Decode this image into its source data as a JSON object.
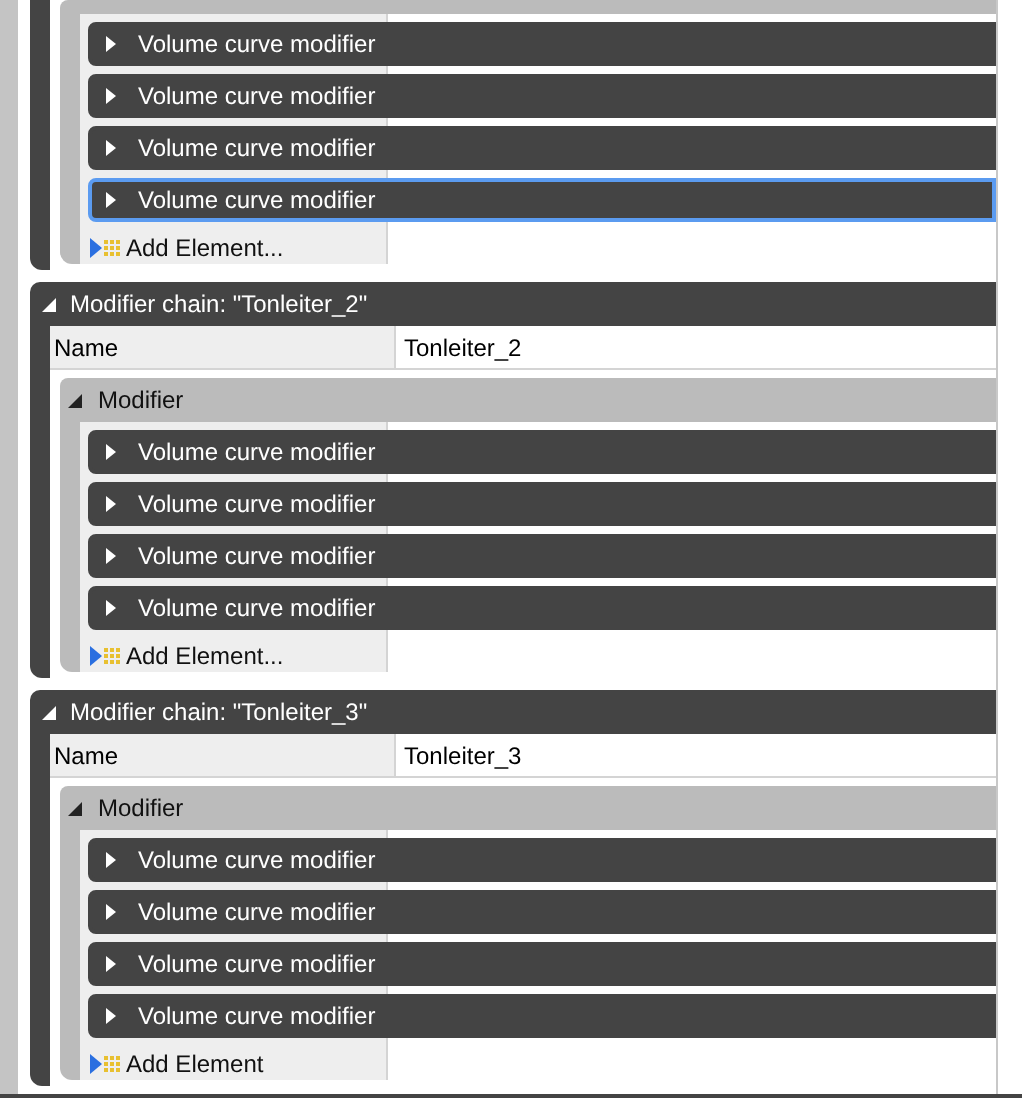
{
  "chains": [
    {
      "group": {
        "rows": [
          {
            "label": "Volume curve modifier",
            "selected": false
          },
          {
            "label": "Volume curve modifier",
            "selected": false
          },
          {
            "label": "Volume curve modifier",
            "selected": false
          },
          {
            "label": "Volume curve modifier",
            "selected": true
          }
        ],
        "add_label": "Add Element..."
      }
    },
    {
      "title": "Modifier chain: \"Tonleiter_2\"",
      "name_label": "Name",
      "name_value": "Tonleiter_2",
      "group": {
        "title": "Modifier",
        "rows": [
          {
            "label": "Volume curve modifier",
            "selected": false
          },
          {
            "label": "Volume curve modifier",
            "selected": false
          },
          {
            "label": "Volume curve modifier",
            "selected": false
          },
          {
            "label": "Volume curve modifier",
            "selected": false
          }
        ],
        "add_label": "Add Element..."
      }
    },
    {
      "title": "Modifier chain: \"Tonleiter_3\"",
      "name_label": "Name",
      "name_value": "Tonleiter_3",
      "group": {
        "title": "Modifier",
        "rows": [
          {
            "label": "Volume curve modifier",
            "selected": false
          },
          {
            "label": "Volume curve modifier",
            "selected": false
          },
          {
            "label": "Volume curve modifier",
            "selected": false
          },
          {
            "label": "Volume curve modifier",
            "selected": false
          }
        ],
        "add_label": "Add Element"
      }
    }
  ]
}
